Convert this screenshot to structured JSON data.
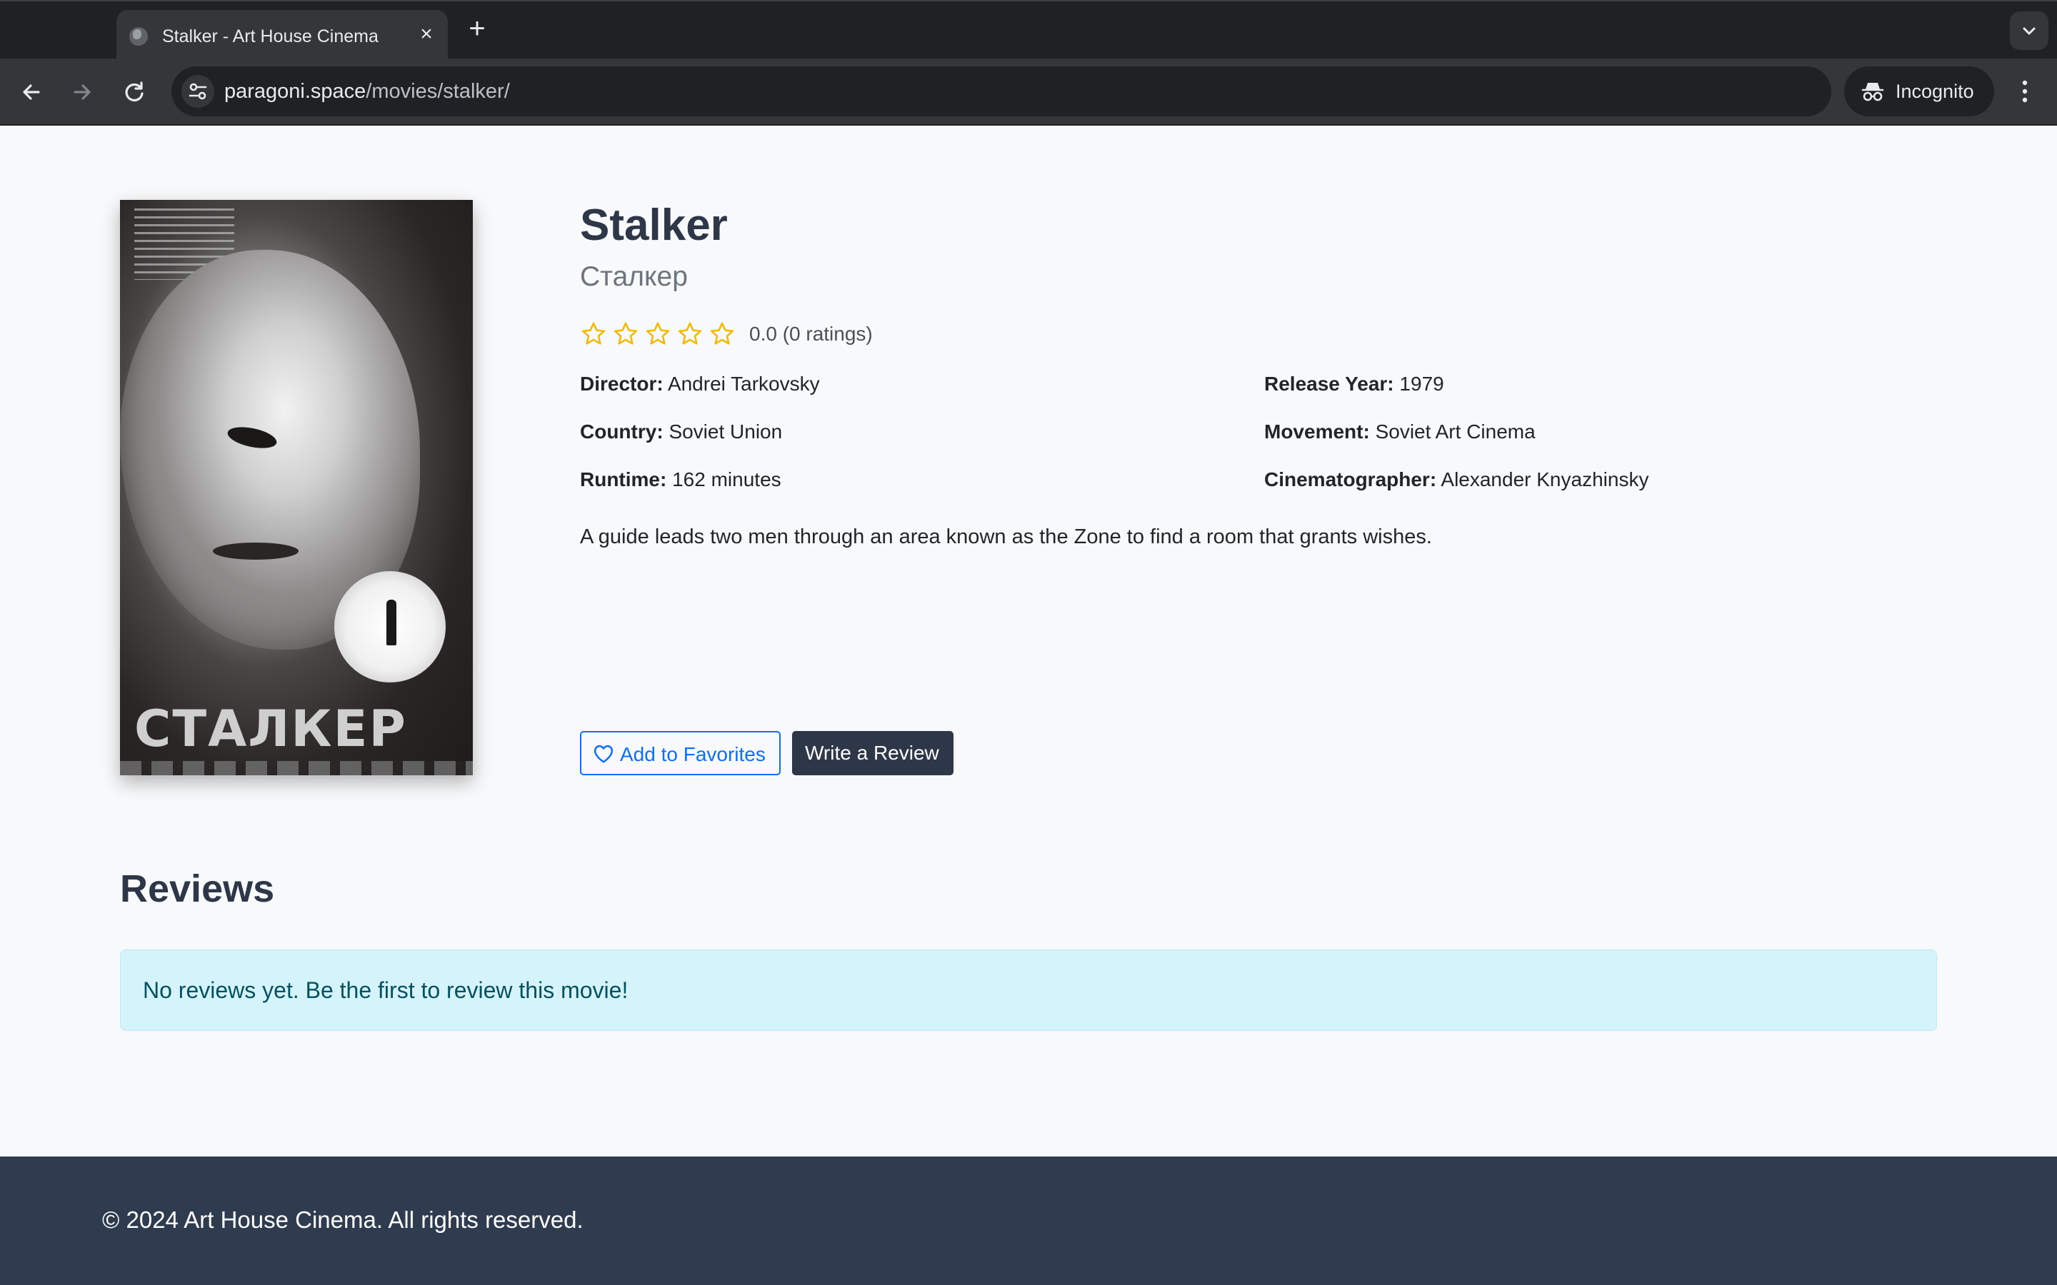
{
  "browser": {
    "tab_title": "Stalker - Art House Cinema",
    "url_domain": "paragoni.space",
    "url_path": "/movies/stalker/",
    "incognito_label": "Incognito"
  },
  "movie": {
    "title": "Stalker",
    "original_title": "Сталкер",
    "poster_title": "СТАЛКЕР",
    "rating": 0.0,
    "stars_max": 5,
    "rating_text": "0.0 (0 ratings)",
    "details": {
      "director_label": "Director:",
      "director": "Andrei Tarkovsky",
      "release_year_label": "Release Year:",
      "release_year": "1979",
      "country_label": "Country:",
      "country": "Soviet Union",
      "movement_label": "Movement:",
      "movement": "Soviet Art Cinema",
      "runtime_label": "Runtime:",
      "runtime": "162 minutes",
      "cinematographer_label": "Cinematographer:",
      "cinematographer": "Alexander Knyazhinsky"
    },
    "description": "A guide leads two men through an area known as the Zone to find a room that grants wishes."
  },
  "actions": {
    "favorites_label": "Add to Favorites",
    "review_label": "Write a Review"
  },
  "reviews": {
    "heading": "Reviews",
    "empty_message": "No reviews yet. Be the first to review this movie!"
  },
  "footer": {
    "copyright": "© 2024 Art House Cinema. All rights reserved."
  },
  "colors": {
    "star": "#f5b800",
    "primary": "#0d6efd",
    "dark": "#2d3748",
    "alert_bg": "#d5f3fa",
    "footer_bg": "#2f3b4e"
  }
}
